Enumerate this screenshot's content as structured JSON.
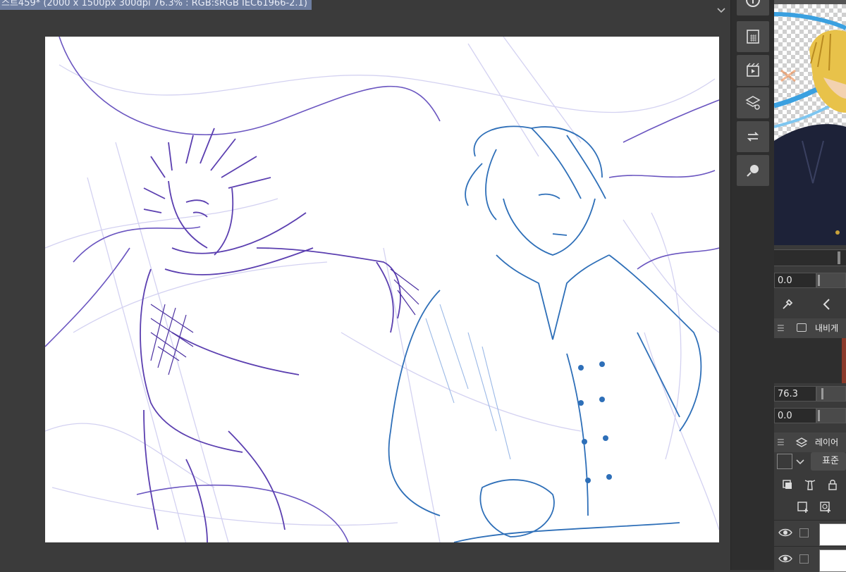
{
  "document_tab": {
    "title": "스트459* (2000 x 1500px 300dpi 76.3% : RGB:sRGB IEC61966-2.1)",
    "close_glyph": "•"
  },
  "tool_strip": {
    "buttons": [
      {
        "icon": "info-icon"
      },
      {
        "icon": "canvas-grid-icon"
      },
      {
        "icon": "animation-icon"
      },
      {
        "icon": "layer-properties-icon"
      },
      {
        "icon": "auto-action-icon"
      },
      {
        "icon": "search-layer-icon"
      }
    ]
  },
  "navigator_controls": {
    "rotation_value": "0.0"
  },
  "navigator_panel": {
    "title": "내비게이",
    "zoom_value": "76.3",
    "angle_value": "0.0"
  },
  "layer_panel": {
    "title": "레이어",
    "blend_mode": "표준"
  },
  "colors": {
    "canvas": "#ffffff",
    "app_bg": "#3a3a3a",
    "tab_bg": "#6e7ea0",
    "sketch_purple": "#5b3fb0",
    "sketch_blue": "#2e6fb8",
    "sketch_light": "#c9c6ee"
  }
}
